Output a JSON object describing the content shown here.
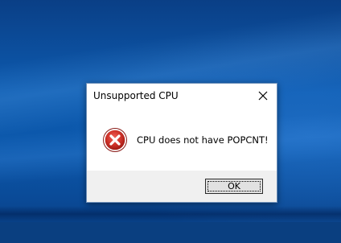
{
  "desktop": {
    "background_color": "#0c57aa"
  },
  "dialog": {
    "title": "Unsupported CPU",
    "message": "CPU does not have POPCNT!",
    "icon": "error-icon",
    "close_icon": "close-icon",
    "ok_label": "OK",
    "accent_colors": {
      "error_red": "#c42b1c",
      "button_face": "#e1e1e1",
      "footer_bg": "#f0f0f0"
    }
  }
}
